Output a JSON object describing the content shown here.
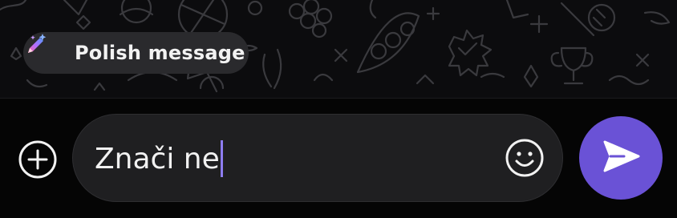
{
  "polish_suggestion": {
    "label": "Polish message",
    "icon": "magic-pen-icon"
  },
  "composer": {
    "attach_icon": "plus-circle-icon",
    "message_value": "Znači ne",
    "emoji_icon": "smiley-icon",
    "send_icon": "send-arrow-icon"
  },
  "colors": {
    "accent": "#6a52d6",
    "caret": "#8d7cf0",
    "field_background": "#1f1f21",
    "chip_background": "#2a2a2d"
  }
}
